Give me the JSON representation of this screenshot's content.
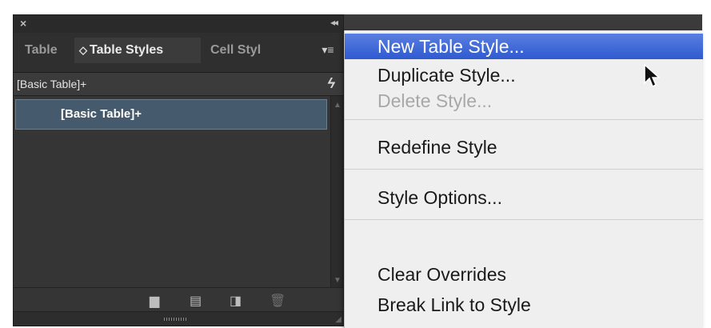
{
  "panel": {
    "tabs": [
      {
        "label": "Table"
      },
      {
        "label": "Table Styles"
      },
      {
        "label": "Cell Styl"
      }
    ],
    "current_style": "[Basic Table]+",
    "list_items": [
      {
        "label": "[Basic Table]+"
      }
    ],
    "colors": {
      "panel_bg": "#3b3b3b",
      "selection": "#465a6e"
    }
  },
  "context_menu": {
    "items": [
      {
        "label": "New Table Style...",
        "state": "highlighted"
      },
      {
        "label": "Duplicate Style..."
      },
      {
        "label": "Delete Style...",
        "state": "disabled"
      },
      {
        "label": "Redefine Style"
      },
      {
        "label": "Style Options..."
      },
      {
        "label": "Clear Overrides"
      },
      {
        "label": "Break Link to Style"
      }
    ],
    "colors": {
      "highlight": "#3a64d8"
    }
  }
}
